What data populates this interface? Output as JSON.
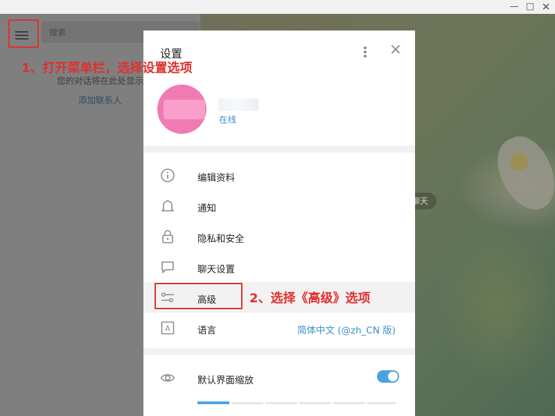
{
  "window": {
    "controls": {
      "minimize": "—",
      "maximize": "□",
      "close": "✕"
    }
  },
  "sidebar": {
    "search_placeholder": "搜索",
    "empty_text": "您的对话将在此处显示",
    "add_contact": "添加联系人",
    "menu_icon": "hamburger-menu-icon"
  },
  "chat": {
    "pill_text": "聊天"
  },
  "settings": {
    "title": "设置",
    "profile": {
      "status": "在线",
      "avatar_color": "#f07bb2"
    },
    "items": [
      {
        "label": "编辑资料",
        "icon": "info-icon"
      },
      {
        "label": "通知",
        "icon": "bell-icon"
      },
      {
        "label": "隐私和安全",
        "icon": "lock-icon"
      },
      {
        "label": "聊天设置",
        "icon": "chat-bubble-icon"
      },
      {
        "label": "高级",
        "icon": "sliders-icon"
      },
      {
        "label": "语言",
        "icon": "language-icon",
        "value": "简体中文 (@zh_CN 版)"
      }
    ],
    "scale": {
      "label": "默认界面缩放",
      "icon": "eye-icon",
      "enabled": true
    }
  },
  "annotations": {
    "step1": "1、打开菜单栏，选择设置选项",
    "step2": "2、选择《高级》选项",
    "color": "#e0302e"
  },
  "colors": {
    "accent": "#4aa3df",
    "link": "#3a8fc5"
  }
}
